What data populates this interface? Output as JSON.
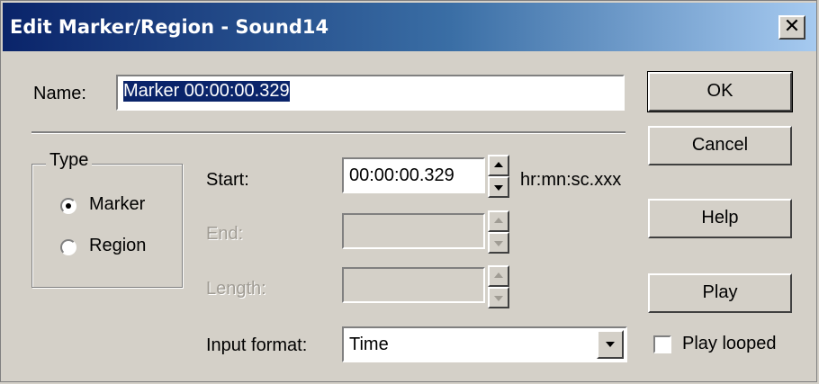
{
  "dialog": {
    "title": "Edit Marker/Region - Sound14",
    "close_glyph": "✕"
  },
  "name_field": {
    "label": "Name:",
    "value": "Marker 00:00:00.329"
  },
  "type_group": {
    "legend": "Type",
    "options": [
      {
        "label": "Marker",
        "selected": true
      },
      {
        "label": "Region",
        "selected": false
      }
    ]
  },
  "fields": {
    "start": {
      "label": "Start:",
      "value": "00:00:00.329",
      "enabled": true
    },
    "end": {
      "label": "End:",
      "value": "",
      "enabled": false
    },
    "length": {
      "label": "Length:",
      "value": "",
      "enabled": false
    },
    "unit_hint": "hr:mn:sc.xxx"
  },
  "input_format": {
    "label": "Input format:",
    "selected": "Time"
  },
  "buttons": {
    "ok": "OK",
    "cancel": "Cancel",
    "help": "Help",
    "play": "Play"
  },
  "play_looped": {
    "label": "Play looped",
    "checked": false
  },
  "icons": {
    "close": "close-icon",
    "spin_up": "spin-up-arrow-icon",
    "spin_down": "spin-down-arrow-icon",
    "dropdown": "chevron-down-icon"
  },
  "colors": {
    "titlebar_start": "#0a246a",
    "titlebar_end": "#a6caf0",
    "face": "#d4d0c8",
    "selection": "#0a246a"
  }
}
